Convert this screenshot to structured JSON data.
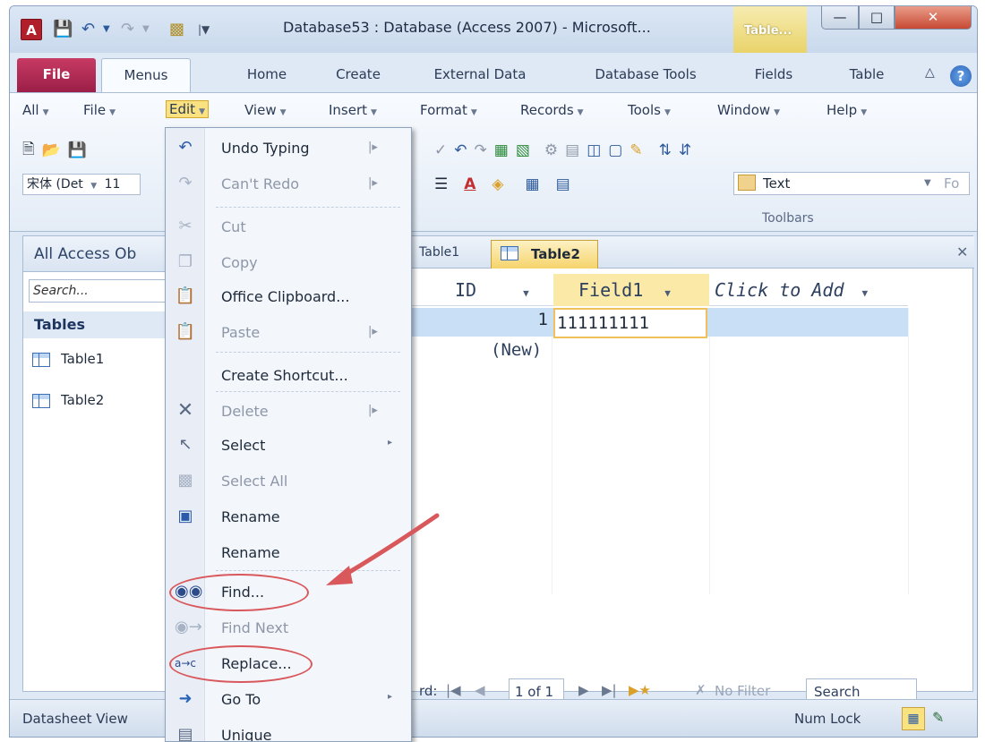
{
  "window": {
    "app_icon": "A",
    "title": "Database53 : Database (Access 2007)  -  Microsoft...",
    "context_tab": "Table...",
    "min_icon": "minimize-icon",
    "max_icon": "maximize-icon",
    "close_icon": "close-icon"
  },
  "ribbon_tabs": [
    "File",
    "Menus",
    "Home",
    "Create",
    "External Data",
    "Database Tools",
    "Fields",
    "Table"
  ],
  "menubar": [
    "All",
    "File",
    "Edit",
    "View",
    "Insert",
    "Format",
    "Records",
    "Tools",
    "Window",
    "Help"
  ],
  "toolbar": {
    "font_name": "宋体 (Det",
    "font_size": "11",
    "text_field": "Text",
    "text_field_extra": "Fo",
    "group_label": "Toolbars"
  },
  "nav": {
    "header": "All Access Ob",
    "search_placeholder": "Search...",
    "section": "Tables",
    "items": [
      "Table1",
      "Table2"
    ]
  },
  "document": {
    "tabs": [
      "Table1",
      "Table2"
    ],
    "columns": [
      "ID",
      "Field1",
      "Click to Add"
    ],
    "rows": [
      {
        "id": "1",
        "field1": "111111111"
      }
    ],
    "new_row": "(New)",
    "record_prefix": "rd:",
    "record_position": "1 of 1",
    "filter": "No Filter",
    "search": "Search"
  },
  "status": {
    "view": "Datasheet View",
    "num_lock": "Num Lock"
  },
  "edit_menu": {
    "items": [
      {
        "label": "Undo Typing",
        "icon": "undo-icon",
        "enabled": true,
        "submenu": "bar"
      },
      {
        "label": "Can't Redo",
        "icon": "redo-icon",
        "enabled": false,
        "submenu": "bar"
      },
      {
        "label": "Cut",
        "icon": "cut-icon",
        "enabled": false
      },
      {
        "label": "Copy",
        "icon": "copy-icon",
        "enabled": false
      },
      {
        "label": "Office Clipboard...",
        "icon": "clipboard-icon",
        "enabled": true
      },
      {
        "label": "Paste",
        "icon": "paste-icon",
        "enabled": false,
        "submenu": "bar"
      },
      {
        "label": "Create Shortcut...",
        "icon": "",
        "enabled": true
      },
      {
        "label": "Delete",
        "icon": "delete-icon",
        "enabled": false,
        "submenu": "bar"
      },
      {
        "label": "Select",
        "icon": "select-icon",
        "enabled": true,
        "submenu": "arrow"
      },
      {
        "label": "Select All",
        "icon": "select-all-icon",
        "enabled": false
      },
      {
        "label": "Rename",
        "icon": "rename-icon",
        "enabled": true
      },
      {
        "label": "Rename",
        "icon": "",
        "enabled": true
      },
      {
        "label": "Find...",
        "icon": "binoculars-icon",
        "enabled": true
      },
      {
        "label": "Find Next",
        "icon": "find-next-icon",
        "enabled": false
      },
      {
        "label": "Replace...",
        "icon": "replace-icon",
        "enabled": true
      },
      {
        "label": "Go To",
        "icon": "goto-arrow-icon",
        "enabled": true,
        "submenu": "arrow"
      },
      {
        "label": "Unique",
        "icon": "unique-icon",
        "enabled": true
      }
    ]
  },
  "colors": {
    "file_tab": "#b02852",
    "highlight": "#f9e27f",
    "annotation": "#d9585c",
    "selection_row": "#c9dff5"
  }
}
